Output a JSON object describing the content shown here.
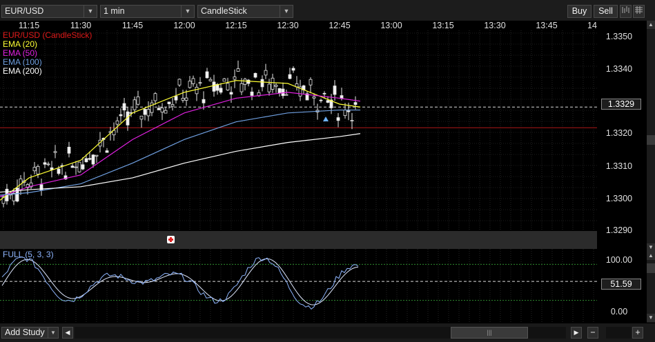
{
  "toolbar": {
    "symbol": "EUR/USD",
    "interval": "1 min",
    "chart_style": "CandleStick",
    "buy_label": "Buy",
    "sell_label": "Sell",
    "icons": [
      "bar-style-icon",
      "grid-icon"
    ]
  },
  "time_axis": {
    "labels": [
      "11:15",
      "11:30",
      "11:45",
      "12:00",
      "12:15",
      "12:30",
      "12:45",
      "13:00",
      "13:15",
      "13:30",
      "13:45",
      "14"
    ]
  },
  "price_axis": {
    "labels": [
      "1.3350",
      "1.3340",
      "1.3329",
      "1.3320",
      "1.3310",
      "1.3300",
      "1.3290"
    ],
    "current_price": "1.3329"
  },
  "osc_axis": {
    "labels": [
      "100.00",
      "51.59",
      "0.00"
    ],
    "current_value": "51.59"
  },
  "legend": {
    "main": "EUR/USD (CandleStick)",
    "ema20": "EMA (20)",
    "ema50": "EMA (50)",
    "ema100": "EMA (100)",
    "ema200": "EMA (200)",
    "oscillator": "FULL (5, 3, 3)"
  },
  "colors": {
    "main": "#e01919",
    "ema20": "#ffff33",
    "ema50": "#e020e0",
    "ema100": "#6f9fe0",
    "ema200": "#ffffff",
    "osc": "#8fb6ff",
    "grid": "#3a3a3a"
  },
  "bottom": {
    "add_study": "Add Study",
    "icons": [
      "scroll-left-icon",
      "scroll-right-icon",
      "zoom-out-icon",
      "zoom-in-icon",
      "scroll-handle-icon"
    ]
  },
  "chart_data": {
    "type": "line",
    "title": "",
    "series": [
      {
        "name": "EMA (20)",
        "x": [
          "11:05",
          "11:15",
          "11:30",
          "11:45",
          "12:00",
          "12:15",
          "12:30",
          "12:45",
          "12:51"
        ],
        "values": [
          1.3296,
          1.3305,
          1.3311,
          1.3327,
          1.3334,
          1.3338,
          1.3337,
          1.333,
          1.3329
        ]
      },
      {
        "name": "EMA (50)",
        "x": [
          "11:05",
          "11:15",
          "11:30",
          "11:45",
          "12:00",
          "12:15",
          "12:30",
          "12:45",
          "12:51"
        ],
        "values": [
          1.3298,
          1.3302,
          1.3306,
          1.3318,
          1.3327,
          1.3332,
          1.3334,
          1.3332,
          1.3331
        ]
      },
      {
        "name": "EMA (100)",
        "x": [
          "11:05",
          "11:15",
          "11:30",
          "11:45",
          "12:00",
          "12:15",
          "12:30",
          "12:45",
          "12:51"
        ],
        "values": [
          1.3299,
          1.33,
          1.3303,
          1.331,
          1.3318,
          1.3324,
          1.3327,
          1.3328,
          1.3328
        ]
      },
      {
        "name": "EMA (200)",
        "x": [
          "11:05",
          "11:15",
          "11:30",
          "11:45",
          "12:00",
          "12:15",
          "12:30",
          "12:45",
          "12:51"
        ],
        "values": [
          1.33,
          1.3301,
          1.3302,
          1.3305,
          1.331,
          1.3314,
          1.3317,
          1.3319,
          1.332
        ]
      }
    ],
    "ylim": [
      1.3287,
      1.3355
    ],
    "horizontal_lines": [
      1.3329,
      1.3322
    ],
    "oscillator": {
      "name": "FULL (5, 3, 3)",
      "ylim": [
        0,
        100
      ],
      "last": 51.59,
      "levels": [
        80,
        20
      ]
    }
  }
}
